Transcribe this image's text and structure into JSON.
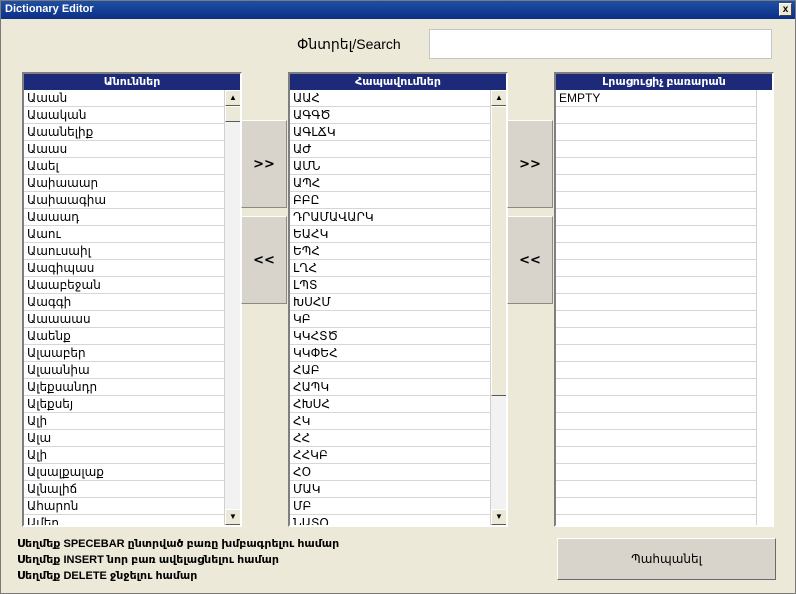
{
  "window": {
    "title": "Dictionary Editor",
    "close_label": "x"
  },
  "search": {
    "label": "Փնտրել/Search",
    "value": "",
    "placeholder": ""
  },
  "panels": {
    "names": {
      "header": "Անուններ",
      "items": [
        "Աաան",
        "Աաական",
        "Աաանելիք",
        "Աաաս",
        "Աաել",
        "Աաիաաար",
        "Աաիաագիա",
        "Աաաադ",
        "Աաու",
        "Աաուսաիլ",
        "Աագիպաս",
        "Աաաբեջան",
        "Աագգի",
        "Աաաաաս",
        "Աաենք",
        "Ալաաբեր",
        "Ալաանիա",
        "Ալեքսանդր",
        "Ալեքսեյ",
        "Ալի",
        "Ալա",
        "Ալի",
        "Ալսալքալաք",
        "Ալնալիճ",
        "Ահարոն",
        "Ամեր"
      ]
    },
    "abbr": {
      "header": "Հապավումներ",
      "items": [
        "ԱԱՀ",
        "ԱԳԳԾ",
        "ԱԳԼՃԿ",
        "ԱԺ",
        "ԱՄՆ",
        "ԱՊՀ",
        "ԲԲԸ",
        "ԴՐԱՄԱՎԱՐԿ",
        "ԵԱՀԿ",
        "ԵՊՀ",
        "ԼՂՀ",
        "ԼՊՏ",
        "ԽՍՀՄ",
        "ԿԲ",
        "ԿԿՀՏԾ",
        "ԿԿՓԵՀ",
        "ՀԱԲ",
        "ՀԱՊԿ",
        "ՀԽՍՀ",
        "ՀԿ",
        "ՀՀ",
        "ՀՀԿԲ",
        "ՀՕ",
        "ՄԱԿ",
        "ՄԲ",
        "ՆԱՏՕ"
      ]
    },
    "custom": {
      "header": "Լրացուցիչ բառարան",
      "items": [
        "EMPTY"
      ]
    }
  },
  "buttons": {
    "move_right": ">>",
    "move_left": "<<",
    "save": "Պահպանել"
  },
  "hints": [
    "Սեղմեք SPECEBAR ընտրված բառը խմբագրելու համար",
    "Սեղմեք INSERT նոր բառ ավելացնելու համար",
    "Սեղմեք DELETE ջնջելու համար"
  ],
  "icons": {
    "scroll_up": "▲",
    "scroll_down": "▼"
  }
}
